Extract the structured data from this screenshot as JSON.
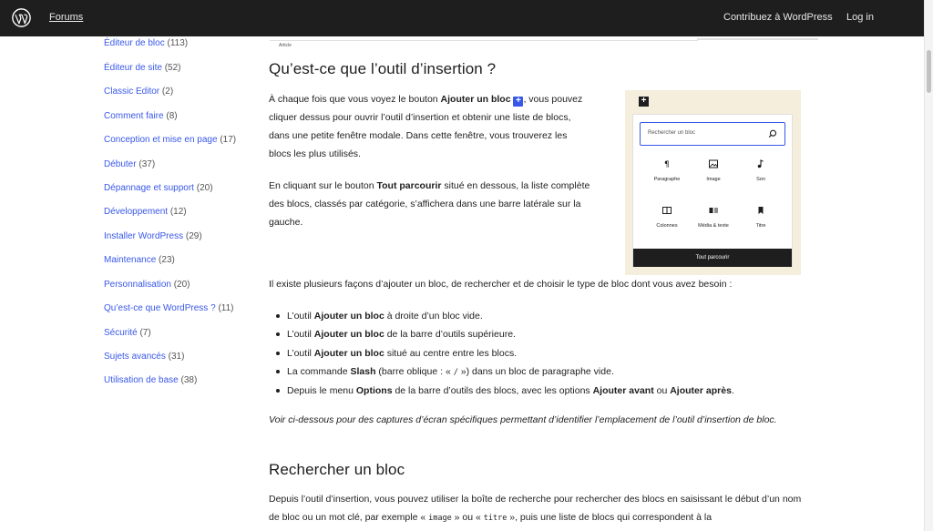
{
  "topbar": {
    "forums": "Forums",
    "contribute": "Contribuez à WordPress",
    "login": "Log in"
  },
  "sidebar": {
    "items": [
      {
        "label": "Éditeur de bloc",
        "count": "(113)"
      },
      {
        "label": "Éditeur de site",
        "count": "(52)"
      },
      {
        "label": "Classic Editor",
        "count": "(2)"
      },
      {
        "label": "Comment faire",
        "count": "(8)"
      },
      {
        "label": "Conception et mise en page",
        "count": "(17)"
      },
      {
        "label": "Débuter",
        "count": "(37)"
      },
      {
        "label": "Dépannage et support",
        "count": "(20)"
      },
      {
        "label": "Développement",
        "count": "(12)"
      },
      {
        "label": "Installer WordPress",
        "count": "(29)"
      },
      {
        "label": "Maintenance",
        "count": "(23)"
      },
      {
        "label": "Personnalisation",
        "count": "(20)"
      },
      {
        "label": "Qu’est-ce que WordPress ?",
        "count": "(11)"
      },
      {
        "label": "Sécurité",
        "count": "(7)"
      },
      {
        "label": "Sujets avancés",
        "count": "(31)"
      },
      {
        "label": "Utilisation de base",
        "count": "(38)"
      }
    ]
  },
  "article": {
    "caption": "Article",
    "h2_inserter": "Qu’est-ce que l’outil d’insertion ?",
    "p1": {
      "a": "À chaque fois que vous voyez le bouton ",
      "b": "Ajouter un bloc",
      "c": ", vous pouvez cliquer dessus pour ouvrir l’outil d’insertion et obtenir une liste de blocs, dans une petite fenêtre modale. Dans cette fenêtre, vous trouverez les blocs les plus utilisés."
    },
    "p2": {
      "a": "En cliquant sur le bouton ",
      "b": "Tout parcourir",
      "c": " situé en dessous, la liste complète des blocs, classés par catégorie, s’affichera dans une barre latérale sur la gauche."
    },
    "p3": "Il existe plusieurs façons d’ajouter un bloc, de rechercher et de choisir le type de bloc dont vous avez besoin :",
    "bullets": [
      {
        "a": "L’outil ",
        "b": "Ajouter un bloc",
        "c": " à droite d’un bloc vide."
      },
      {
        "a": "L’outil ",
        "b": "Ajouter un bloc",
        "c": " de la barre d’outils supérieure."
      },
      {
        "a": "L’outil ",
        "b": "Ajouter un bloc",
        "c": " situé au centre entre les blocs."
      },
      {
        "a": "La commande ",
        "b": "Slash",
        "c": " (barre oblique : « ",
        "code": "/",
        "d": " ») dans un bloc de paragraphe vide."
      },
      {
        "a": "Depuis le menu ",
        "b": "Options",
        "c": " de la barre d’outils des blocs, avec les options ",
        "d": "Ajouter avant",
        "e": " ou ",
        "f": "Ajouter après",
        "g": "."
      }
    ],
    "p4_italic": "Voir ci-dessous pour des captures d’écran spécifiques permettant d’identifier l’emplacement de l’outil d’insertion de bloc.",
    "h2_search": "Rechercher un bloc",
    "p5": {
      "a": "Depuis l’outil d’insertion, vous pouvez utiliser la boîte de recherche pour rechercher des blocs en saisissant le début d’un nom de bloc ou un mot clé, par exemple « ",
      "code1": "image",
      "b": " » ou « ",
      "code2": "titre",
      "c": " », puis une liste de blocs qui correspondent à la"
    }
  },
  "inserter": {
    "search_placeholder": "Rechercher un bloc",
    "blocks": [
      {
        "label": "Paragraphe",
        "icon": "paragraph-icon"
      },
      {
        "label": "Image",
        "icon": "image-icon"
      },
      {
        "label": "Son",
        "icon": "audio-icon"
      },
      {
        "label": "Colonnes",
        "icon": "columns-icon"
      },
      {
        "label": "Média & texte",
        "icon": "media-text-icon"
      },
      {
        "label": "Titre",
        "icon": "heading-icon"
      }
    ],
    "browse_all": "Tout parcourir"
  },
  "colors": {
    "topbar_bg": "#1e1e1e",
    "link_blue": "#3858e9",
    "illustration_bg": "#f5eedd"
  }
}
